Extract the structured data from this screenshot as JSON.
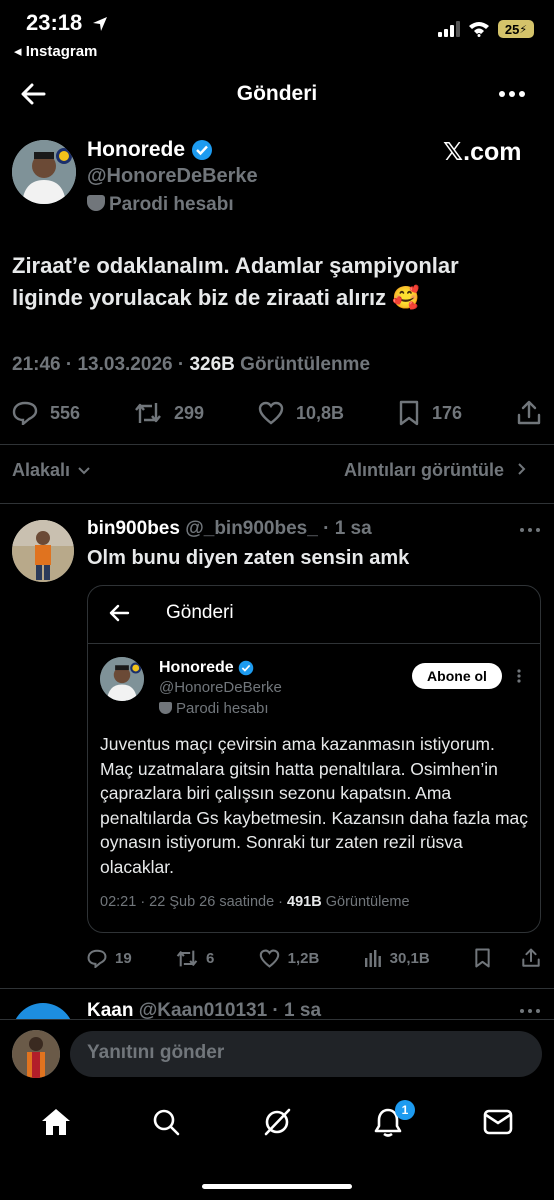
{
  "status_bar": {
    "time": "23:18",
    "back_app": "◂ Instagram",
    "battery": "25"
  },
  "nav": {
    "title": "Gönderi"
  },
  "post": {
    "display_name": "Honorede",
    "handle": "@HonoreDeBerke",
    "parody_label": "Parodi hesabı",
    "source_logo": "𝕏.com",
    "text": "Ziraat’e odaklanalım. Adamlar şampiyonlar liginde yorulacak biz de ziraati alırız 🥰",
    "time": "21:46 · 13.03.2026 · ",
    "views_count": "326B",
    "views_label": " Görüntülenme",
    "replies": "556",
    "reposts": "299",
    "likes": "10,8B",
    "bookmarks": "176"
  },
  "filters": {
    "relevance": "Alakalı",
    "view_quotes": "Alıntıları görüntüle"
  },
  "reply": {
    "display_name": "bin900bes",
    "handle": "@_bin900bes_",
    "age": "· 1 sa",
    "text": "Olm bunu diyen zaten sensin amk",
    "replies": "19",
    "reposts": "6",
    "likes": "1,2B",
    "views": "30,1B"
  },
  "quoted_screenshot": {
    "nav_title": "Gönderi",
    "display_name": "Honorede",
    "handle": "@HonoreDeBerke",
    "parody_label": "Parodi hesabı",
    "subscribe_label": "Abone ol",
    "text": "Juventus maçı çevirsin ama kazanmasın istiyorum. Maç uzatmalara gitsin hatta penaltılara. Osimhen’in çaprazlara biri çalışsın sezonu kapatsın. Ama penaltılarda Gs kaybetmesin. Kazansın daha fazla maç oynasın istiyorum. Sonraki tur zaten rezil rüsva olacaklar.",
    "meta_time": "02:21 · 22 Şub 26 saatinde · ",
    "meta_views": "491B",
    "meta_views_label": " Görüntüleme"
  },
  "next_reply": {
    "display_name": "Kaan",
    "handle": "@Kaan010131",
    "age": "· 1 sa"
  },
  "composer": {
    "placeholder": "Yanıtını gönder"
  },
  "tabbar": {
    "notification_count": "1"
  },
  "colors": {
    "accent": "#1d9bf0",
    "background": "#000000",
    "muted": "#71767b"
  }
}
